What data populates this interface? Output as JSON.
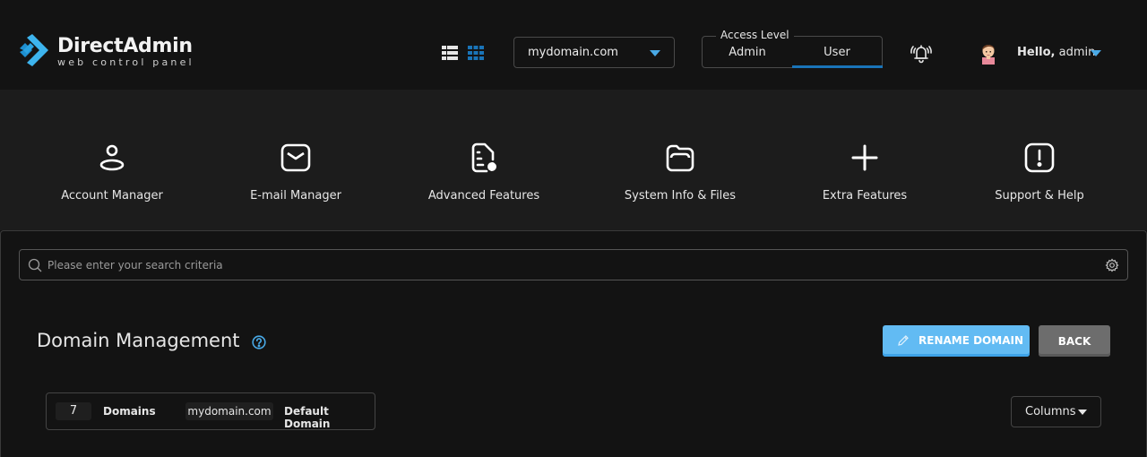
{
  "header": {
    "logo_title": "DirectAdmin",
    "logo_subtitle": "web control panel",
    "view_icons": [
      "list-view-icon",
      "grid-view-icon"
    ],
    "domain_select": {
      "value": "mydomain.com"
    },
    "access_level": {
      "legend": "Access Level",
      "options": [
        "Admin",
        "User"
      ],
      "selected": "User"
    },
    "notifications_icon": "bell-icon",
    "user": {
      "greeting": "Hello,",
      "name": "admin"
    }
  },
  "nav": {
    "items": [
      {
        "label": "Account Manager",
        "icon": "user-icon"
      },
      {
        "label": "E-mail Manager",
        "icon": "mail-icon"
      },
      {
        "label": "Advanced Features",
        "icon": "document-gear-icon"
      },
      {
        "label": "System Info & Files",
        "icon": "folder-icon"
      },
      {
        "label": "Extra Features",
        "icon": "plus-icon"
      },
      {
        "label": "Support & Help",
        "icon": "exclamation-icon"
      }
    ]
  },
  "search": {
    "placeholder": "Please enter your search criteria",
    "value": ""
  },
  "page": {
    "title": "Domain Management",
    "rename_label": "RENAME DOMAIN",
    "back_label": "BACK"
  },
  "stats": {
    "count": "7",
    "count_label": "Domains",
    "default_domain": "mydomain.com",
    "default_label": "Default Domain"
  },
  "columns_label": "Columns",
  "colors": {
    "accent": "#49a9e6",
    "primary_button": "#62bbf3",
    "secondary_button": "#6d6d6d",
    "access_underline": "#1a74b8"
  }
}
